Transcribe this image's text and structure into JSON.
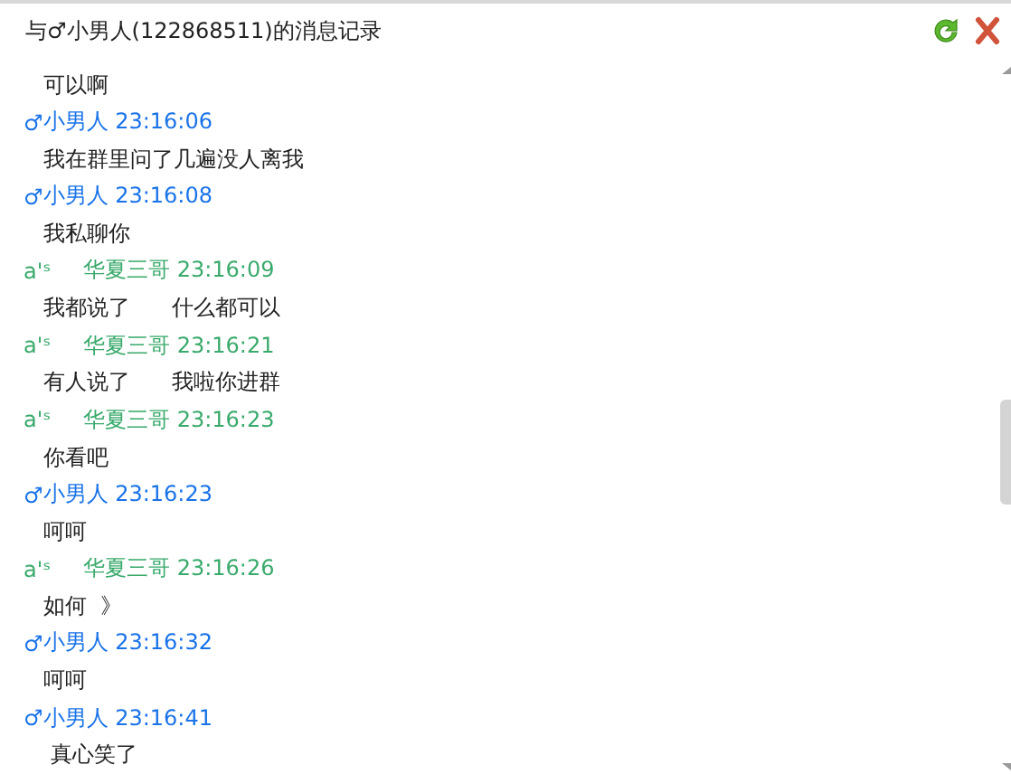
{
  "window": {
    "title": "与♂小男人(122868511)的消息记录"
  },
  "lines": [
    {
      "kind": "message",
      "text": "可以啊"
    },
    {
      "kind": "sender",
      "prefix": "♂",
      "name": "小男人",
      "time": "23:16:06",
      "color": "#1a73e8"
    },
    {
      "kind": "message",
      "text": "我在群里问了几遍没人离我"
    },
    {
      "kind": "sender",
      "prefix": "♂",
      "name": "小男人",
      "time": "23:16:08",
      "color": "#1a73e8"
    },
    {
      "kind": "message",
      "text": "我私聊你"
    },
    {
      "kind": "sender",
      "prefix": "a'ˢ",
      "name": "华夏三哥",
      "time": "23:16:09",
      "color": "#3aaa6c"
    },
    {
      "kind": "message",
      "text": "我都说了      什么都可以"
    },
    {
      "kind": "sender",
      "prefix": "a'ˢ",
      "name": "华夏三哥",
      "time": "23:16:21",
      "color": "#3aaa6c"
    },
    {
      "kind": "message",
      "text": "有人说了      我啦你进群"
    },
    {
      "kind": "sender",
      "prefix": "a'ˢ",
      "name": "华夏三哥",
      "time": "23:16:23",
      "color": "#3aaa6c"
    },
    {
      "kind": "message",
      "text": "你看吧"
    },
    {
      "kind": "sender",
      "prefix": "♂",
      "name": "小男人",
      "time": "23:16:23",
      "color": "#1a73e8"
    },
    {
      "kind": "message",
      "text": "呵呵"
    },
    {
      "kind": "sender",
      "prefix": "a'ˢ",
      "name": "华夏三哥",
      "time": "23:16:26",
      "color": "#3aaa6c"
    },
    {
      "kind": "message",
      "text": "如何  》"
    },
    {
      "kind": "sender",
      "prefix": "♂",
      "name": "小男人",
      "time": "23:16:32",
      "color": "#1a73e8"
    },
    {
      "kind": "message",
      "text": "呵呵"
    },
    {
      "kind": "sender",
      "prefix": "♂",
      "name": "小男人",
      "time": "23:16:41",
      "color": "#1a73e8"
    },
    {
      "kind": "message",
      "text": " 真心笑了"
    }
  ]
}
